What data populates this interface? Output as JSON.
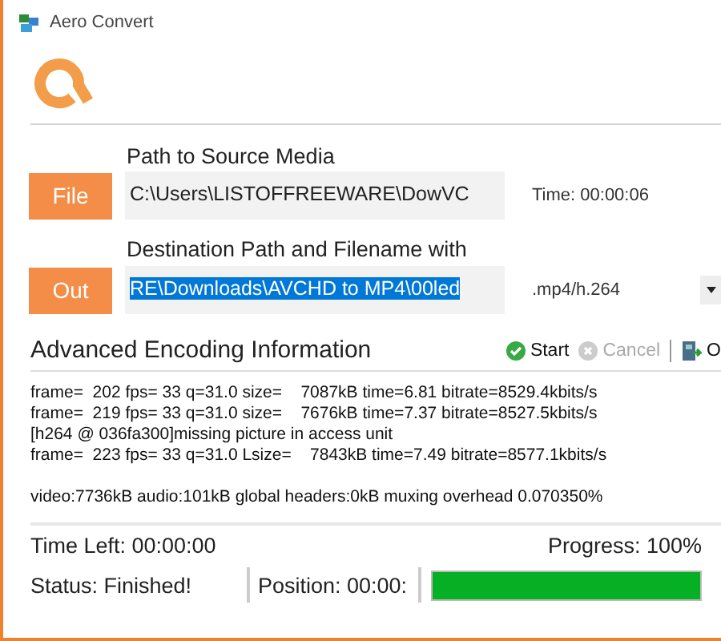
{
  "window": {
    "title": "Aero Convert"
  },
  "source": {
    "label": "Path to Source Media",
    "button": "File",
    "value": "C:\\Users\\LISTOFFREEWARE\\DowVC",
    "time": "Time: 00:00:06"
  },
  "destination": {
    "label": "Destination Path and Filename with",
    "button": "Out",
    "value": "RE\\Downloads\\AVCHD  to MP4\\00led",
    "selected": true,
    "format": ".mp4/h.264"
  },
  "encoding": {
    "title": "Advanced Encoding Information",
    "actions": [
      {
        "label": "Start",
        "kind": "start",
        "disabled": false
      },
      {
        "label": "Cancel",
        "kind": "cancel",
        "disabled": true
      },
      {
        "label": "O",
        "kind": "open",
        "disabled": false
      }
    ],
    "log": [
      "frame=  202 fps= 33 q=31.0 size=    7087kB time=6.81 bitrate=8529.4kbits/s",
      "frame=  219 fps= 33 q=31.0 size=    7676kB time=7.37 bitrate=8527.5kbits/s",
      "[h264 @ 036fa300]missing picture in access unit",
      "frame=  223 fps= 33 q=31.0 Lsize=    7843kB time=7.49 bitrate=8577.1kbits/s"
    ],
    "summary": "video:7736kB audio:101kB global headers:0kB muxing overhead 0.070350%"
  },
  "status_bar": {
    "time_left": "Time Left: 00:00:00",
    "progress_text": "Progress: 100%",
    "status": "Status: Finished!",
    "position": "Position: 00:00:",
    "progress": {
      "level": 1
    }
  }
}
